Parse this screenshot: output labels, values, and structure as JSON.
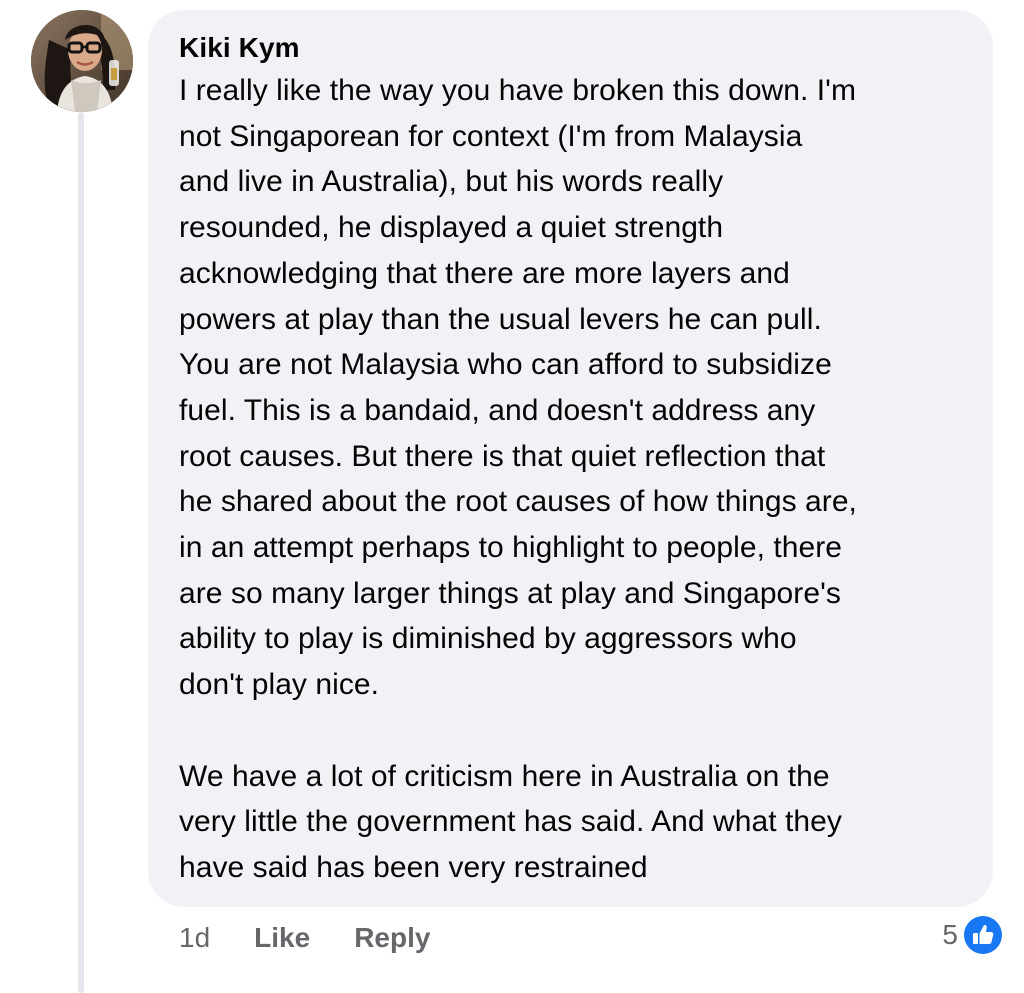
{
  "comment": {
    "author": "Kiki Kym",
    "paragraphs": [
      "I really like the way you have broken this down. I'm\nnot Singaporean for context (I'm from Malaysia\nand live in Australia), but his words really\nresounded, he displayed a quiet strength\nacknowledging that there are more layers and\npowers at play than the usual levers he can pull.\nYou are not Malaysia who can afford to subsidize\nfuel. This is a bandaid, and doesn't address any\nroot causes. But there is that quiet reflection that\nhe shared about the root causes of how things are,\nin an attempt perhaps to highlight to people, there\nare so many larger things at play and Singapore's\nability to play is diminished by aggressors who\ndon't play nice.",
      "We have a lot of criticism here in Australia on  the\nvery little the government has said. And what they\nhave said has been very restrained"
    ],
    "timestamp": "1d",
    "like_label": "Like",
    "reply_label": "Reply",
    "reaction_count": "5",
    "reaction_icon": "thumbs-up-icon"
  },
  "colors": {
    "bubble": "#f0f2f5",
    "meta_text": "#65676b",
    "like_blue": "#1877f2",
    "thread_line": "#e4e6eb"
  }
}
